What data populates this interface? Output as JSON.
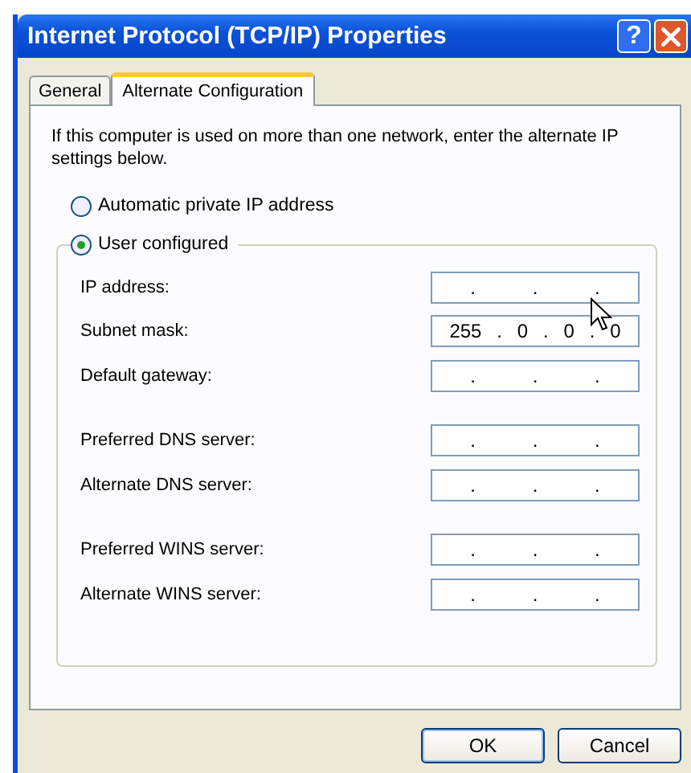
{
  "window": {
    "title": "Internet Protocol (TCP/IP) Properties",
    "help_button": "?"
  },
  "tabs": [
    {
      "label": "General",
      "selected": false
    },
    {
      "label": "Alternate Configuration",
      "selected": true
    }
  ],
  "intro": "If this computer is used on more than one network, enter the alternate IP settings below.",
  "options": [
    {
      "label": "Automatic private IP address",
      "selected": false
    },
    {
      "label": "User configured",
      "selected": true
    }
  ],
  "field_groups": [
    [
      {
        "label": "IP address:",
        "parts": [
          ".",
          ".",
          "."
        ]
      },
      {
        "label": "Subnet mask:",
        "parts": [
          "255",
          ".",
          "0",
          ".",
          "0",
          ".",
          "0"
        ]
      },
      {
        "label": "Default gateway:",
        "parts": [
          ".",
          ".",
          "."
        ]
      }
    ],
    [
      {
        "label": "Preferred DNS server:",
        "parts": [
          ".",
          ".",
          "."
        ]
      },
      {
        "label": "Alternate DNS server:",
        "parts": [
          ".",
          ".",
          "."
        ]
      }
    ],
    [
      {
        "label": "Preferred WINS server:",
        "parts": [
          ".",
          ".",
          "."
        ]
      },
      {
        "label": "Alternate WINS server:",
        "parts": [
          ".",
          ".",
          "."
        ]
      }
    ]
  ],
  "buttons": [
    "OK",
    "Cancel"
  ]
}
